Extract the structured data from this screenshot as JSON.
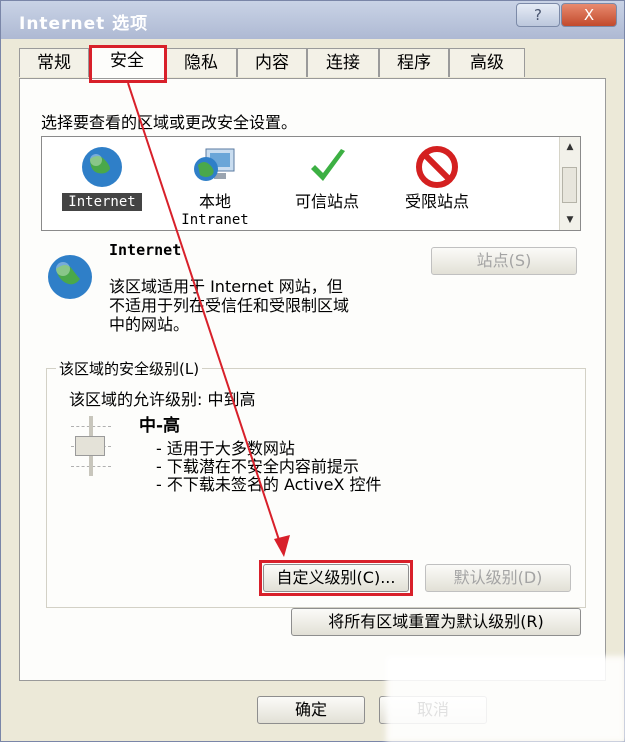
{
  "window": {
    "title": "Internet 选项",
    "help_button": "?",
    "close_button": "X"
  },
  "tabs": [
    "常规",
    "安全",
    "隐私",
    "内容",
    "连接",
    "程序",
    "高级"
  ],
  "security": {
    "instruction": "选择要查看的区域或更改安全设置。",
    "zones": [
      {
        "label1": "Internet",
        "label2": ""
      },
      {
        "label1": "本地",
        "label2": "Intranet"
      },
      {
        "label1": "可信站点",
        "label2": ""
      },
      {
        "label1": "受限站点",
        "label2": ""
      }
    ],
    "zone_title": "Internet",
    "zone_desc_1": "该区域适用于 Internet 网站，但",
    "zone_desc_2": "不适用于列在受信任和受限制区域",
    "zone_desc_3": "中的网站。",
    "sites_button": "站点(S)",
    "level_group_label": "该区域的安全级别(L)",
    "allowed_level": "该区域的允许级别: 中到高",
    "level_name": "中-高",
    "level_bullets": [
      "- 适用于大多数网站",
      "- 下载潜在不安全内容前提示",
      "- 不下载未签名的 ActiveX 控件"
    ],
    "custom_level_button": "自定义级别(C)...",
    "default_level_button": "默认级别(D)",
    "reset_all_button": "将所有区域重置为默认级别(R)"
  },
  "footer": {
    "ok_button": "确定",
    "cancel_button": "取消"
  },
  "colors": {
    "dialog_bg": "#ECE9D8",
    "highlight_box": "#D8202A",
    "arrow": "#D8202A"
  }
}
